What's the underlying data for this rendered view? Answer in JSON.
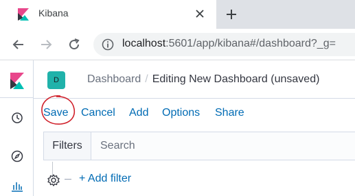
{
  "browser": {
    "tab_title": "Kibana",
    "url_host": "localhost",
    "url_rest": ":5601/app/kibana#/dashboard?_g="
  },
  "icons": {
    "favicon": "kibana-logo-icon",
    "tab_close": "close-icon",
    "new_tab": "plus-icon",
    "back": "arrow-left-icon",
    "forward": "arrow-right-icon",
    "reload": "reload-icon",
    "site_info": "info-icon",
    "nav_recent": "clock-icon",
    "nav_discover": "compass-icon",
    "nav_visualize": "bar-chart-icon",
    "filter_settings": "gear-icon"
  },
  "colors": {
    "link": "#006bb4",
    "space_avatar": "#20b2aa",
    "annotation_circle": "#d0202a",
    "kibana_pink": "#e8478b",
    "kibana_teal": "#00bfb3",
    "kibana_dark": "#343741"
  },
  "header": {
    "space_initial": "D",
    "breadcrumbs": [
      "Dashboard",
      "Editing New Dashboard (unsaved)"
    ]
  },
  "top_menu": {
    "items": [
      "Save",
      "Cancel",
      "Add",
      "Options",
      "Share"
    ]
  },
  "query_bar": {
    "filters_label": "Filters",
    "search_placeholder": "Search"
  },
  "filter_bar": {
    "add_filter": "+ Add filter"
  }
}
